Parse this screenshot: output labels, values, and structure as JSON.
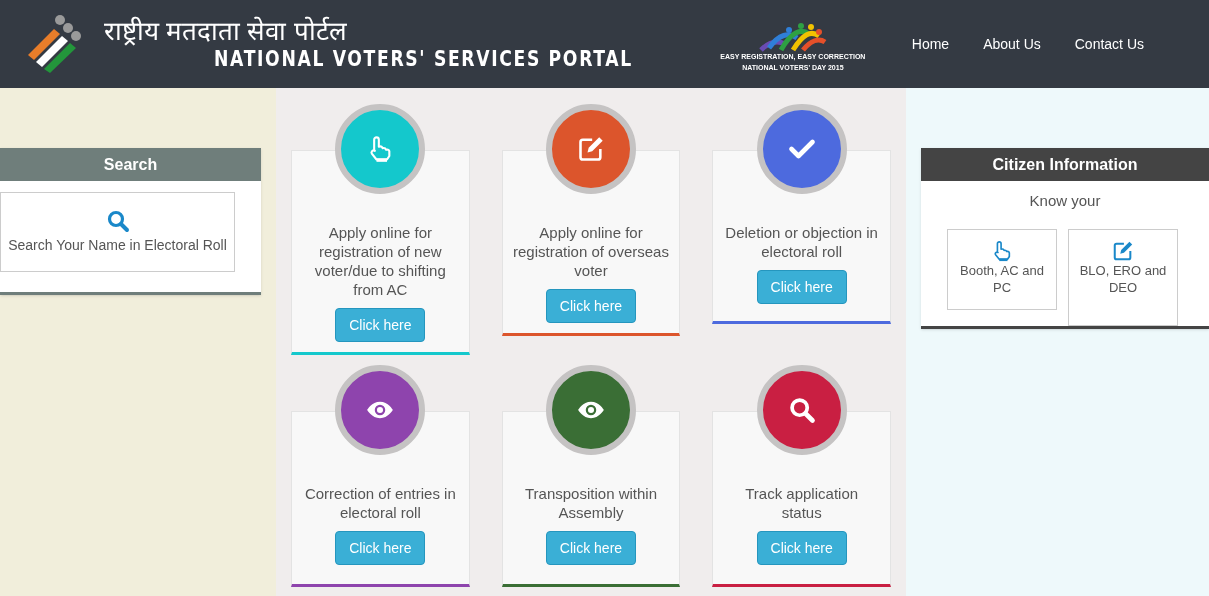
{
  "header": {
    "title_hindi": "राष्ट्रीय मतदाता सेवा पोर्टल",
    "title_english": "NATIONAL VOTERS' SERVICES PORTAL",
    "badge": {
      "line_1": "EASY REGISTRATION, EASY CORRECTION",
      "line_2": "NATIONAL VOTERS' DAY 2015"
    },
    "nav": [
      {
        "label": "Home"
      },
      {
        "label": "About Us"
      },
      {
        "label": "Contact Us"
      }
    ]
  },
  "search_panel": {
    "heading": "Search",
    "link_label": "Search Your Name in Electoral Roll"
  },
  "services": [
    {
      "kind": "hand",
      "title": "Apply online for registration of new voter/due to shifting from AC",
      "button": "Click here",
      "color": "#14c8cc"
    },
    {
      "kind": "edit",
      "title": "Apply online for registration of overseas voter",
      "button": "Click here",
      "color": "#dc552c"
    },
    {
      "kind": "check",
      "title": "Deletion or objection in electoral roll",
      "button": "Click here",
      "color": "#4d6ade"
    },
    {
      "kind": "eye",
      "title": "Correction of entries in electoral roll",
      "button": "Click here",
      "color": "#8e44ad"
    },
    {
      "kind": "eye",
      "title": "Transposition within Assembly",
      "button": "Click here",
      "color": "#3a6e35"
    },
    {
      "kind": "search",
      "title": "Track application status",
      "button": "Click here",
      "color": "#c91f42"
    }
  ],
  "citizen_panel": {
    "heading": "Citizen Information",
    "subheading": "Know your",
    "items": [
      {
        "kind": "hand",
        "label": "Booth, AC and PC"
      },
      {
        "kind": "edit",
        "label": "BLO, ERO and DEO"
      }
    ]
  }
}
